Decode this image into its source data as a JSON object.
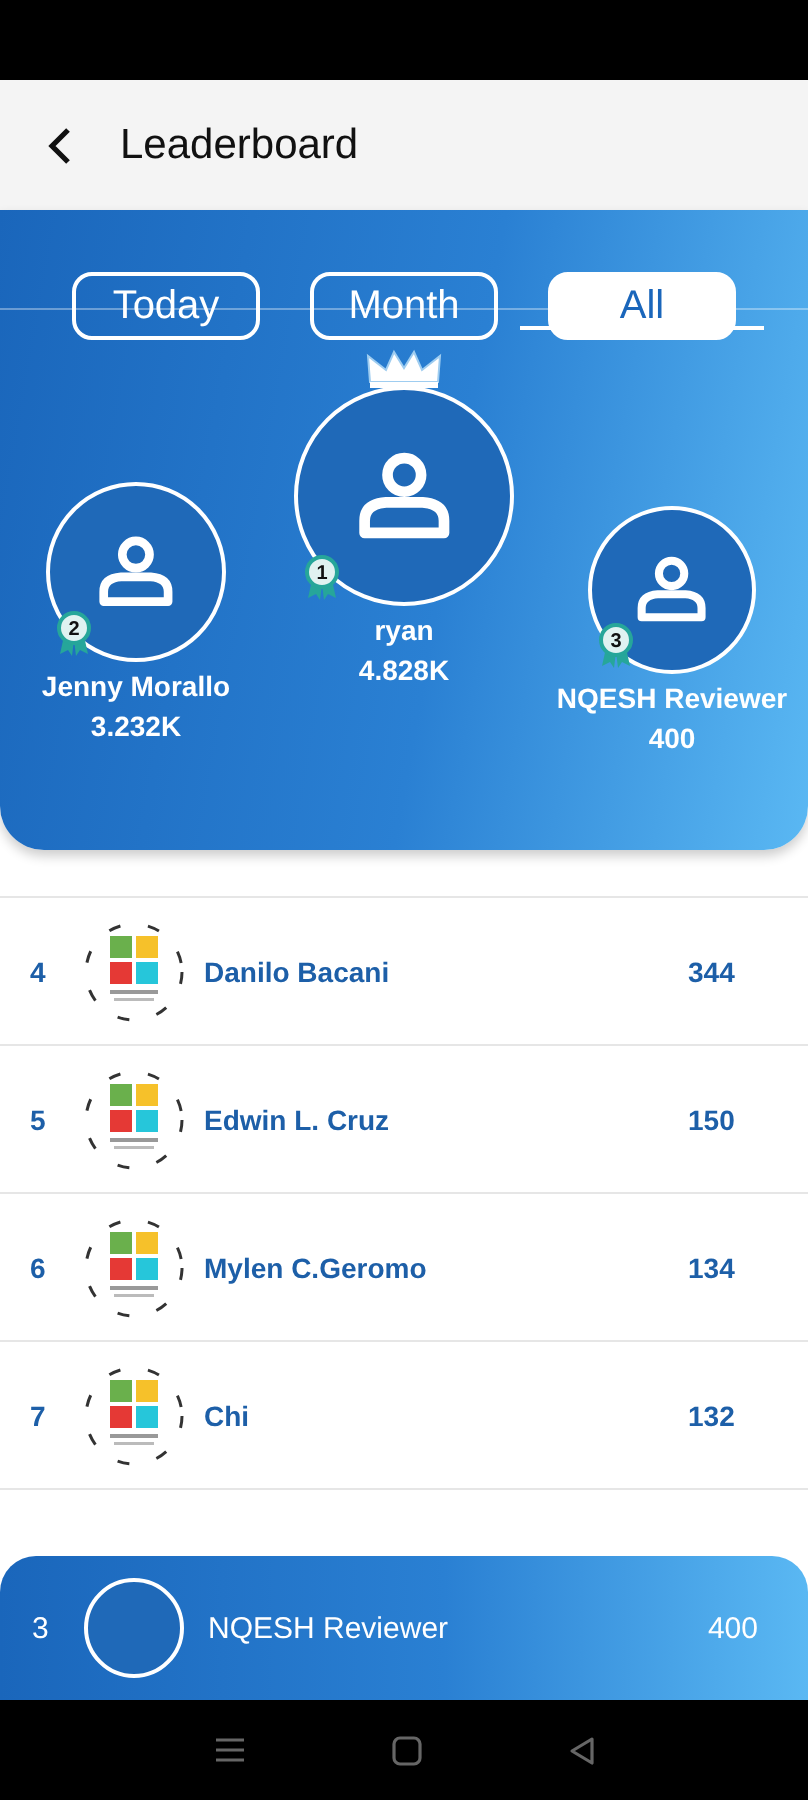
{
  "header": {
    "title": "Leaderboard"
  },
  "tabs": [
    {
      "label": "Today",
      "selected": false
    },
    {
      "label": "Month",
      "selected": false
    },
    {
      "label": "All",
      "selected": true
    }
  ],
  "podium": [
    {
      "rank": "2",
      "name": "Jenny Morallo",
      "score": "3.232K"
    },
    {
      "rank": "1",
      "name": "ryan",
      "score": "4.828K"
    },
    {
      "rank": "3",
      "name": "NQESH Reviewer",
      "score": "400"
    }
  ],
  "rows": [
    {
      "rank": "4",
      "name": "Danilo Bacani",
      "score": "344"
    },
    {
      "rank": "5",
      "name": "Edwin L. Cruz",
      "score": "150"
    },
    {
      "rank": "6",
      "name": "Mylen C.Geromo",
      "score": "134"
    },
    {
      "rank": "7",
      "name": "Chi",
      "score": "132"
    }
  ],
  "my_rank": {
    "rank": "3",
    "name": "NQESH Reviewer",
    "score": "400"
  }
}
